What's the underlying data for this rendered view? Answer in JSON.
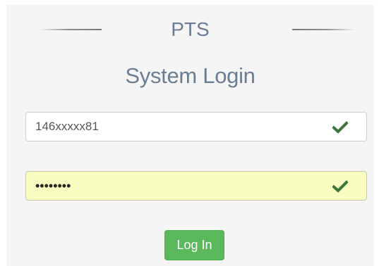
{
  "brand": {
    "title": "PTS"
  },
  "login": {
    "heading": "System Login",
    "username_value": "146xxxxx81",
    "password_masked": "••••••••",
    "submit_label": "Log In"
  },
  "icons": {
    "username_status": "checkmark-icon",
    "password_status": "checkmark-icon"
  },
  "colors": {
    "title_text": "#6b7d92",
    "success_green": "#3c763d",
    "button_green": "#5cb85c",
    "autofill_yellow": "#fafdc0"
  }
}
